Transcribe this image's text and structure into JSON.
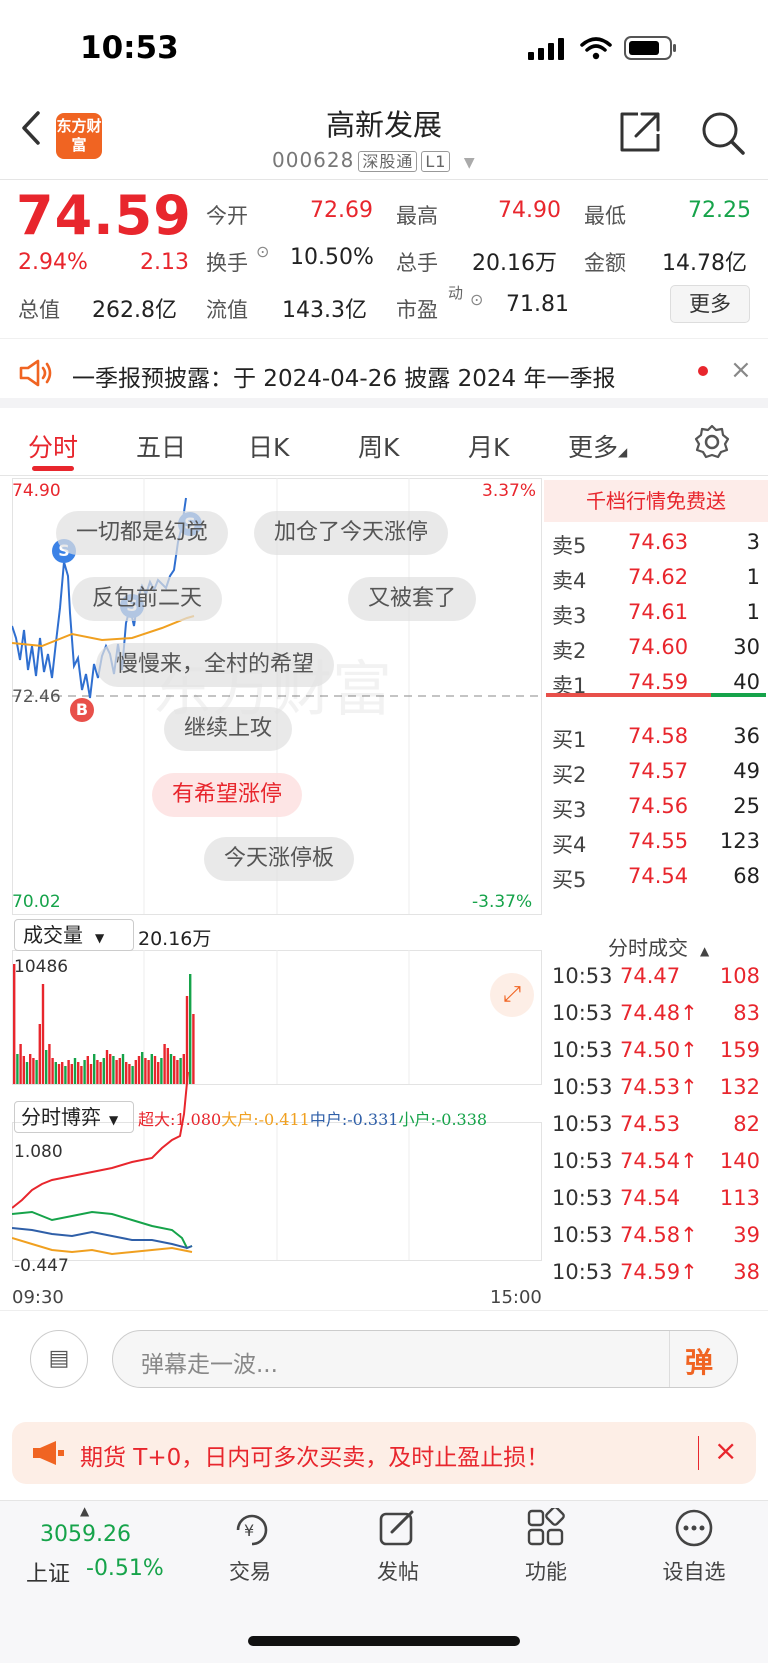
{
  "status_bar": {
    "time": "10:53"
  },
  "header": {
    "logo_text": "东方财富",
    "stock_name": "高新发展",
    "stock_code": "000628",
    "tag1": "深股通",
    "tag2": "L1"
  },
  "quote": {
    "price": "74.59",
    "change_pct": "2.94%",
    "change": "2.13",
    "metrics": [
      {
        "label": "今开",
        "value": "72.69",
        "color": "#e8262d"
      },
      {
        "label": "最高",
        "value": "74.90",
        "color": "#e8262d"
      },
      {
        "label": "最低",
        "value": "72.25",
        "color": "#16a34a"
      },
      {
        "label": "换手",
        "value": "10.50%",
        "color": "#222"
      },
      {
        "label": "总手",
        "value": "20.16万",
        "color": "#222"
      },
      {
        "label": "金额",
        "value": "14.78亿",
        "color": "#222"
      },
      {
        "label": "总值",
        "value": "262.8亿",
        "color": "#222"
      },
      {
        "label": "流值",
        "value": "143.3亿",
        "color": "#222"
      },
      {
        "label": "市盈",
        "value": "71.81",
        "color": "#222"
      }
    ],
    "pe_superscript": "动",
    "more_label": "更多"
  },
  "notice": {
    "text": "一季报预披露：于 2024-04-26 披露 2024 年一季报"
  },
  "tabs": [
    "分时",
    "五日",
    "日K",
    "周K",
    "月K",
    "更多"
  ],
  "chart": {
    "price_high": "74.90",
    "price_low": "70.02",
    "price_mid": "72.46",
    "pct_high": "3.37%",
    "pct_low": "-3.37%",
    "danmu": [
      "一切都是幻觉",
      "加仓了今天涨停",
      "反包前二天",
      "又被套了",
      "慢慢来，全村的希望",
      "继续上攻",
      "有希望涨停",
      "今天涨停板"
    ],
    "volume_label": "成交量",
    "volume_total": "20.16万",
    "volume_max": "10486",
    "game_label": "分时博弈",
    "game_values": [
      {
        "name": "超大",
        "value": "1.080",
        "color": "#e8262d"
      },
      {
        "name": "大户",
        "value": "-0.411",
        "color": "#f0a020"
      },
      {
        "name": "中户",
        "value": "-0.331",
        "color": "#2f5fa8"
      },
      {
        "name": "小户",
        "value": "-0.338",
        "color": "#16a34a"
      }
    ],
    "game_max": "1.080",
    "game_min": "-0.447",
    "time_start": "09:30",
    "time_end": "15:00",
    "watermark": "东方财富",
    "markers": [
      "S",
      "S",
      "S",
      "B"
    ]
  },
  "orderbook": {
    "header": "千档行情免费送",
    "asks": [
      {
        "label": "卖5",
        "price": "74.63",
        "vol": "3"
      },
      {
        "label": "卖4",
        "price": "74.62",
        "vol": "1"
      },
      {
        "label": "卖3",
        "price": "74.61",
        "vol": "1"
      },
      {
        "label": "卖2",
        "price": "74.60",
        "vol": "30"
      },
      {
        "label": "卖1",
        "price": "74.59",
        "vol": "40"
      }
    ],
    "bids": [
      {
        "label": "买1",
        "price": "74.58",
        "vol": "36"
      },
      {
        "label": "买2",
        "price": "74.57",
        "vol": "49"
      },
      {
        "label": "买3",
        "price": "74.56",
        "vol": "25"
      },
      {
        "label": "买4",
        "price": "74.55",
        "vol": "123"
      },
      {
        "label": "买5",
        "price": "74.54",
        "vol": "68"
      }
    ],
    "ticks_header": "分时成交",
    "ticks": [
      {
        "time": "10:53",
        "price": "74.47",
        "vol": "108"
      },
      {
        "time": "10:53",
        "price": "74.48↑",
        "vol": "83"
      },
      {
        "time": "10:53",
        "price": "74.50↑",
        "vol": "159"
      },
      {
        "time": "10:53",
        "price": "74.53↑",
        "vol": "132"
      },
      {
        "time": "10:53",
        "price": "74.53",
        "vol": "82"
      },
      {
        "time": "10:53",
        "price": "74.54↑",
        "vol": "140"
      },
      {
        "time": "10:53",
        "price": "74.54",
        "vol": "113"
      },
      {
        "time": "10:53",
        "price": "74.58↑",
        "vol": "39"
      },
      {
        "time": "10:53",
        "price": "74.59↑",
        "vol": "38"
      }
    ]
  },
  "comment": {
    "placeholder": "弹幕走一波...",
    "danmu_button": "弹"
  },
  "ad": {
    "text": "期货 T+0，日内可多次买卖，及时止盈止损！"
  },
  "bottom_nav": {
    "index_value": "3059.26",
    "index_name": "上证",
    "index_change": "-0.51%",
    "items": [
      "交易",
      "发帖",
      "功能",
      "设自选"
    ]
  }
}
